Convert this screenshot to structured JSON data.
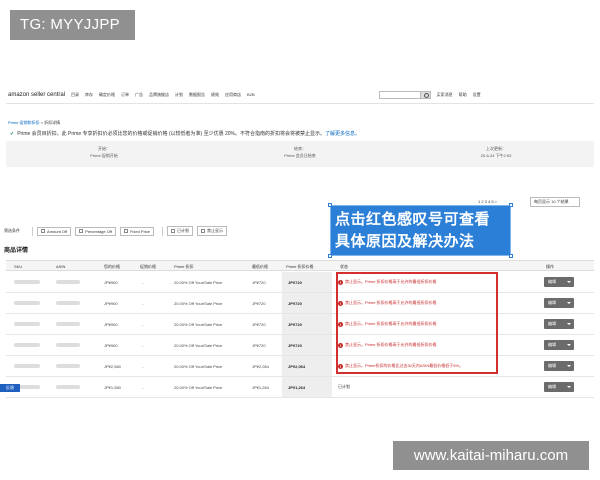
{
  "watermark_top": "TG: MYYJJPP",
  "watermark_bottom": "www.kaitai-miharu.com",
  "nav": {
    "logo": "amazon",
    "logo_sub": " seller central",
    "items": [
      "目录",
      "库存",
      "确定价格",
      "订单",
      "广告",
      "品牌旗舰店",
      "计划",
      "数据报告",
      "绩效",
      "应用商店",
      "B2B"
    ],
    "right_links": [
      "买家消息",
      "帮助",
      "设置"
    ]
  },
  "breadcrumb": {
    "link": "Prime 促销和折扣",
    "separator": " > ",
    "current": "折扣详情"
  },
  "notice": {
    "text": "Prime 会员目折扣。此 Prime 专享折扣价必须比您的价格或促销价格 (以较低者为准) 至少优惠 20%。不符合指南的折扣将会将被禁止显示。",
    "link": "了解更多信息。"
  },
  "info": [
    {
      "label": "开始：",
      "value": "Prime 促销开始"
    },
    {
      "label": "结束：",
      "value": "Prime 会员日结束"
    },
    {
      "label": "上次更新：",
      "value": "20-6-24 下午2:53"
    }
  ],
  "pagination": "1  2  3  4  5  >",
  "page_size": "每页显示 10 个结果",
  "filters": {
    "label": "筛选条件",
    "chips": [
      "Amount Off",
      "Percentage Off",
      "Fixed Price"
    ],
    "chips2": [
      "已计划",
      "禁止显示"
    ]
  },
  "details_title": "商品详情",
  "table": {
    "headers": [
      "SKU",
      "ASIN",
      "您的价格",
      "促销价格",
      "Prime 折扣",
      "最低价格",
      "Prime 折扣价格",
      "状态",
      "操作"
    ],
    "rows": [
      {
        "your_price": "JP¥900",
        "promo": "-",
        "discount": "20.00% Off Your/Sale Price",
        "min_price": "JP¥720",
        "prime_price": "JP¥720",
        "status": "禁止显示。Prime 折扣价格高于允许的最低折扣价格",
        "error": true
      },
      {
        "your_price": "JP¥900",
        "promo": "-",
        "discount": "20.00% Off Your/Sale Price",
        "min_price": "JP¥720",
        "prime_price": "JP¥720",
        "status": "禁止显示。Prime 折扣价格高于允许的最低折扣价格",
        "error": true
      },
      {
        "your_price": "JP¥900",
        "promo": "-",
        "discount": "20.00% Off Your/Sale Price",
        "min_price": "JP¥720",
        "prime_price": "JP¥720",
        "status": "禁止显示。Prime 折扣价格高于允许的最低折扣价格",
        "error": true
      },
      {
        "your_price": "JP¥900",
        "promo": "-",
        "discount": "20.00% Off Your/Sale Price",
        "min_price": "JP¥720",
        "prime_price": "JP¥720",
        "status": "禁止显示。Prime 折扣价格高于允许的最低折扣价格",
        "error": true
      },
      {
        "your_price": "JP¥2,580",
        "promo": "-",
        "discount": "20.00% Off Your/Sale Price",
        "min_price": "JP¥2,064",
        "prime_price": "JP¥2,064",
        "status": "禁止显示。Prime折扣的价格比过去30天内ASIN最低价格低于5%。",
        "error": true
      },
      {
        "your_price": "JP¥1,580",
        "promo": "-",
        "discount": "20.00% Off Your/Sale Price",
        "min_price": "JP¥1,264",
        "prime_price": "JP¥1,264",
        "status": "已计划",
        "error": false
      }
    ],
    "action_label": "编辑"
  },
  "callout": {
    "line1": "点击红色感叹号可查看",
    "line2": "具体原因及解决办法"
  },
  "side_tab": "反馈",
  "colors": {
    "error": "#c62828",
    "highlight_box": "#d32f2f",
    "callout_bg": "#2c7fd6"
  }
}
